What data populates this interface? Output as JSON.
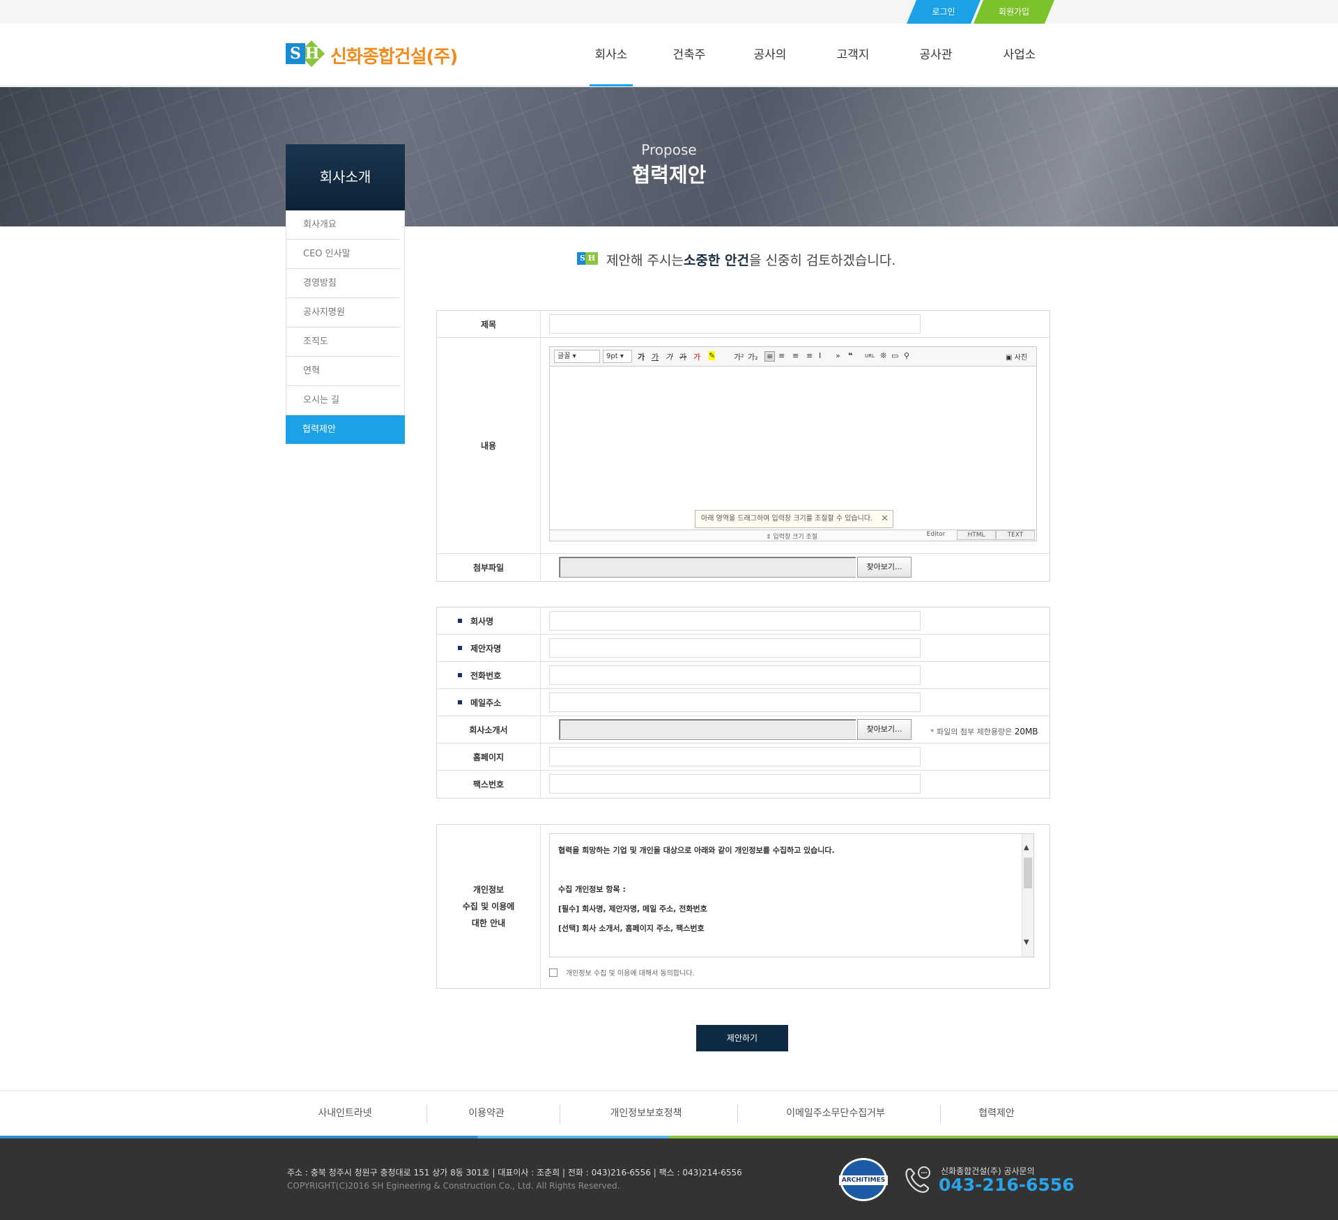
{
  "top": {
    "login": "로그인",
    "join": "회원가입"
  },
  "logo": {
    "mark_s": "S",
    "mark_h": "H",
    "text": "신화종합건설(주)"
  },
  "nav": [
    "회사소개",
    "건축주",
    "공사의뢰",
    "고객지원",
    "공사관리",
    "사업소개"
  ],
  "banner": {
    "subtitle": "Propose",
    "title": "협력제안"
  },
  "sidebar": {
    "title": "회사소개",
    "items": [
      "회사개요",
      "CEO 인사말",
      "경영방침",
      "공사지명원",
      "조직도",
      "연혁",
      "오시는 길",
      "협력제안"
    ],
    "active_index": 7
  },
  "intro": {
    "pre": "제안해 주시는 ",
    "bold": "소중한 안건",
    "post": "을 신중히 검토하겠습니다."
  },
  "form1": {
    "title_label": "제목",
    "content_label": "내용",
    "attach_label": "첨부파일",
    "browse": "찾아보기...",
    "editor": {
      "font": "글꼴",
      "size": "9pt",
      "photo": "사진",
      "tip": "아래 영역을 드래그하여 입력창 크기를 조절할 수 있습니다.",
      "resize": "입력창 크기 조절",
      "modes": [
        "Editor",
        "HTML",
        "TEXT"
      ]
    }
  },
  "form2": {
    "company": "회사명",
    "proposer": "제안자명",
    "phone": "전화번호",
    "email": "메일주소",
    "intro_doc": "회사소개서",
    "homepage": "홈페이지",
    "fax": "팩스번호",
    "browse": "찾아보기...",
    "note_pre": "* 파일의 첨부 제한용량은 ",
    "note_size": "20MB"
  },
  "privacy": {
    "label_line1": "개인정보",
    "label_line2": "수집 및 이용에",
    "label_line3": "대한 안내",
    "text": [
      "협력을 희망하는 기업 및 개인을 대상으로 아래와 같이 개인정보를 수집하고 있습니다.",
      "",
      "수집 개인정보 항목 :",
      "[필수] 회사명, 제안자명, 메일 주소, 전화번호",
      "[선택] 회사 소개서, 홈페이지 주소, 팩스번호"
    ],
    "agree": "개인정보 수집 및 이용에 대해서 동의합니다."
  },
  "submit": "제안하기",
  "footer": {
    "links": [
      "사내인트라넷",
      "이용약관",
      "개인정보보호정책",
      "이메일주소무단수집거부",
      "협력제안"
    ],
    "address": "주소 : 충북 청주시 청원구 충청대로 151 상가 8동 301호   |   대표이사 : 조춘희   |   전화 : 043)216-6556   |   팩스 : 043)214-6556",
    "copyright": "COPYRIGHT(C)2016  SH Egineering & Construction  Co., Ltd. All Rights Reserved.",
    "badge": "ARCHITIMES",
    "cs_label": "신화종합건설(주) 공사문의",
    "cs_phone": "043-216-6556"
  },
  "colors": {
    "accent_blue": "#1aa1e6",
    "accent_green": "#7cc22b",
    "logo_orange": "#f08c1e",
    "navy": "#0f2a44",
    "footer_bg": "#333333"
  }
}
